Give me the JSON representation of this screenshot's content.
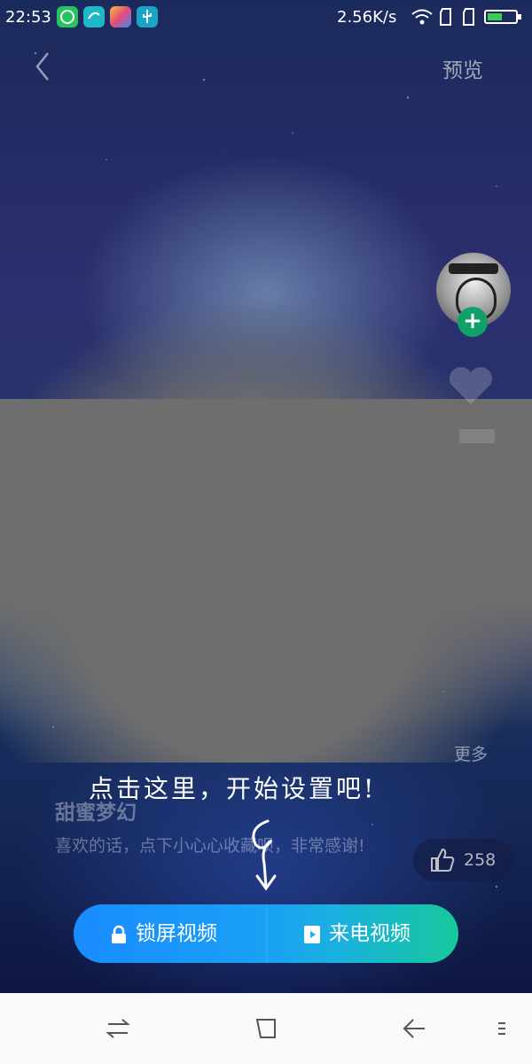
{
  "status_bar": {
    "time": "22:53",
    "net_speed": "2.56K/s",
    "app_icons": [
      "chat-app-icon",
      "sync-app-icon",
      "gallery-app-icon",
      "usb-icon"
    ],
    "battery_color": "#3ccf4e"
  },
  "header": {
    "preview": "预览"
  },
  "sidebar": {
    "more": "更多"
  },
  "hint": "点击这里，开始设置吧!",
  "content": {
    "title": "甜蜜梦幻",
    "description": "喜欢的话，点下小心心收藏呗，非常感谢!"
  },
  "like": {
    "count": "258"
  },
  "actions": {
    "lock_screen": "锁屏视频",
    "incoming_call": "来电视频"
  },
  "colors": {
    "follow_green": "#12a06a",
    "button_start": "#1a8cff",
    "button_end": "#16c99a"
  }
}
